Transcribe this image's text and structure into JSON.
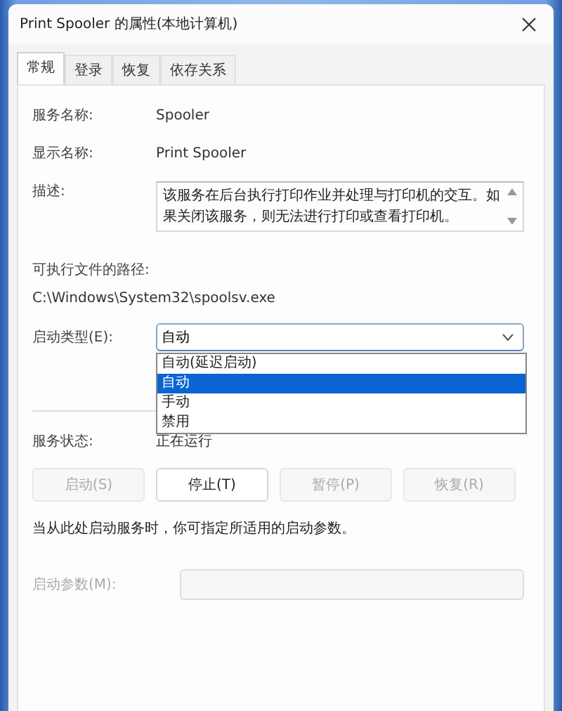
{
  "window": {
    "title": "Print Spooler 的属性(本地计算机)"
  },
  "tabs": [
    {
      "label": "常规",
      "selected": true
    },
    {
      "label": "登录",
      "selected": false
    },
    {
      "label": "恢复",
      "selected": false
    },
    {
      "label": "依存关系",
      "selected": false
    }
  ],
  "service_name": {
    "label": "服务名称:",
    "value": "Spooler"
  },
  "display_name": {
    "label": "显示名称:",
    "value": "Print Spooler"
  },
  "description": {
    "label": "描述:",
    "value": "该服务在后台执行打印作业并处理与打印机的交互。如果关闭该服务，则无法进行打印或查看打印机。"
  },
  "executable_path": {
    "label": "可执行文件的路径:",
    "value": "C:\\Windows\\System32\\spoolsv.exe"
  },
  "startup_type": {
    "label": "启动类型(E):",
    "value": "自动",
    "expanded": true,
    "options": [
      {
        "label": "自动(延迟启动)",
        "selected": false
      },
      {
        "label": "自动",
        "selected": true
      },
      {
        "label": "手动",
        "selected": false
      },
      {
        "label": "禁用",
        "selected": false
      }
    ]
  },
  "service_status": {
    "label": "服务状态:",
    "value": "正在运行"
  },
  "buttons": [
    {
      "label": "启动(S)",
      "disabled": true
    },
    {
      "label": "停止(T)",
      "disabled": false
    },
    {
      "label": "暂停(P)",
      "disabled": true
    },
    {
      "label": "恢复(R)",
      "disabled": true
    }
  ],
  "hint": "当从此处启动服务时，你可指定所适用的启动参数。",
  "start_parameters": {
    "label": "启动参数(M):",
    "disabled": true
  }
}
